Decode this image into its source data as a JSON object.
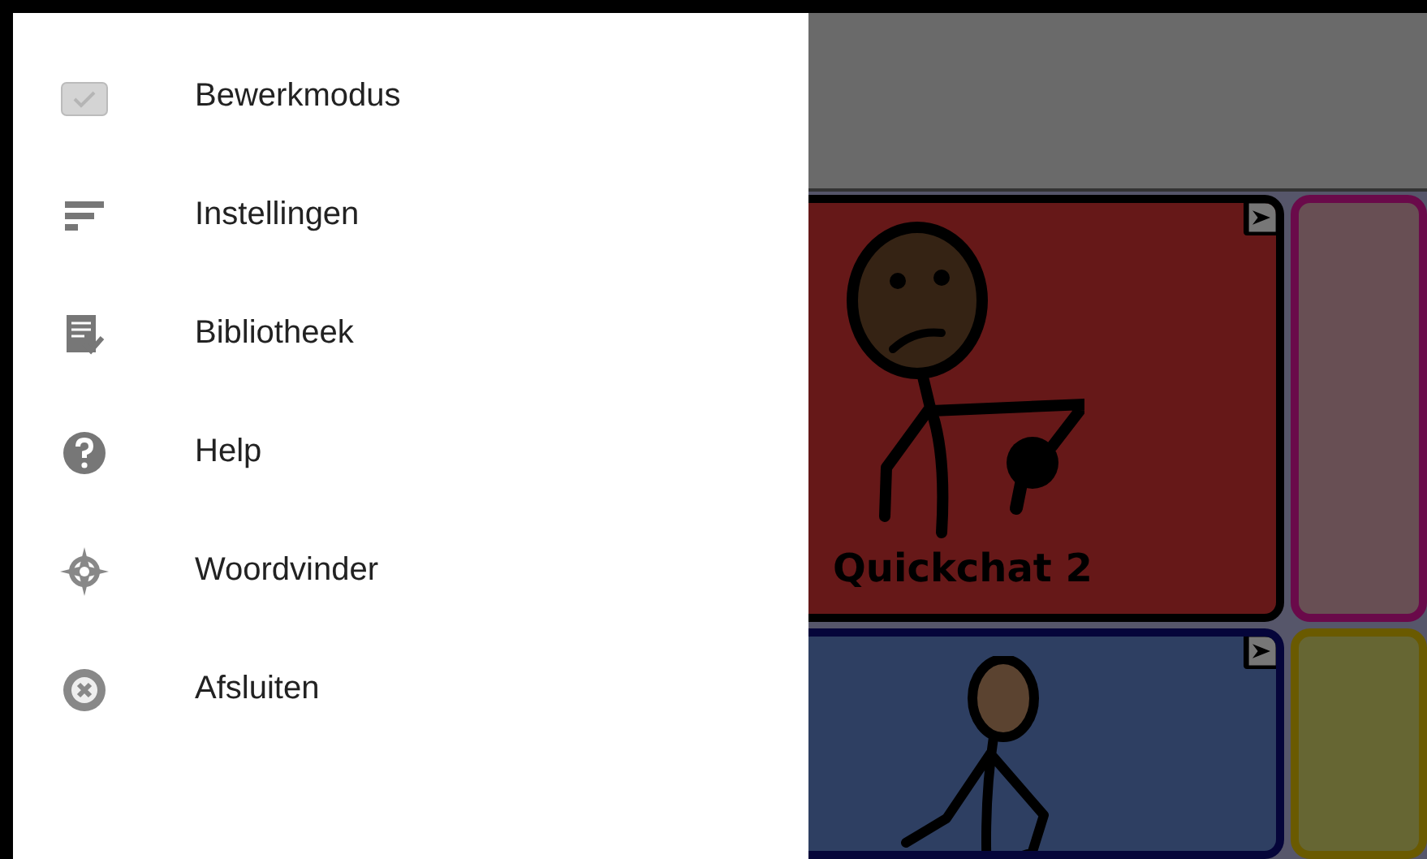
{
  "menu": [
    {
      "label": "Bewerkmodus",
      "kind": "checkbox"
    },
    {
      "label": "Instellingen",
      "kind": "lines"
    },
    {
      "label": "Bibliotheek",
      "kind": "checklist"
    },
    {
      "label": "Help",
      "kind": "help"
    },
    {
      "label": "Woordvinder",
      "kind": "compass"
    },
    {
      "label": "Afsluiten",
      "kind": "close"
    }
  ],
  "tiles": [
    {
      "label": "Quickchat 2",
      "color": "#661818",
      "kind": "folder",
      "figure": {
        "kind": "sad"
      }
    },
    {
      "color": "#684f54",
      "kind": "button"
    },
    {
      "color": "#2e3f62",
      "kind": "folder",
      "figure": {
        "kind": "sitting"
      }
    },
    {
      "color": "#666633",
      "kind": "button"
    }
  ]
}
